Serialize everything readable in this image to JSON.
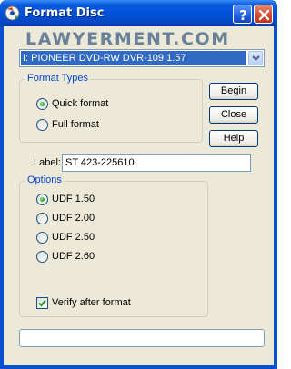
{
  "window": {
    "title": "Format Disc",
    "help_button_glyph": "?",
    "close_button_glyph": "✕"
  },
  "watermark": "LAWYERMENT.COM",
  "drive_select": {
    "selected": "I: PIONEER DVD-RW  DVR-109 1.57"
  },
  "format_types": {
    "title": "Format Types",
    "options": [
      {
        "label": "Quick format",
        "selected": true
      },
      {
        "label": "Full format",
        "selected": false
      }
    ]
  },
  "buttons": {
    "begin": "Begin",
    "close": "Close",
    "help": "Help"
  },
  "label_field": {
    "caption": "Label:",
    "value": "ST 423-225610"
  },
  "options": {
    "title": "Options",
    "udf_versions": [
      {
        "label": "UDF 1.50",
        "selected": true
      },
      {
        "label": "UDF 2.00",
        "selected": false
      },
      {
        "label": "UDF 2.50",
        "selected": false
      },
      {
        "label": "UDF 2.60",
        "selected": false
      }
    ],
    "verify_label": "Verify after format",
    "verify_checked": true
  },
  "progress": {
    "value": 0
  },
  "colors": {
    "title_bar": "#0451d8",
    "dialog_bg": "#ece9d8",
    "group_title": "#0046d5",
    "selection": "#316ac5"
  },
  "icons": {
    "app": "format-disc-app-icon",
    "help": "question-mark-icon",
    "close": "close-x-icon",
    "dropdown": "chevron-down-icon"
  }
}
